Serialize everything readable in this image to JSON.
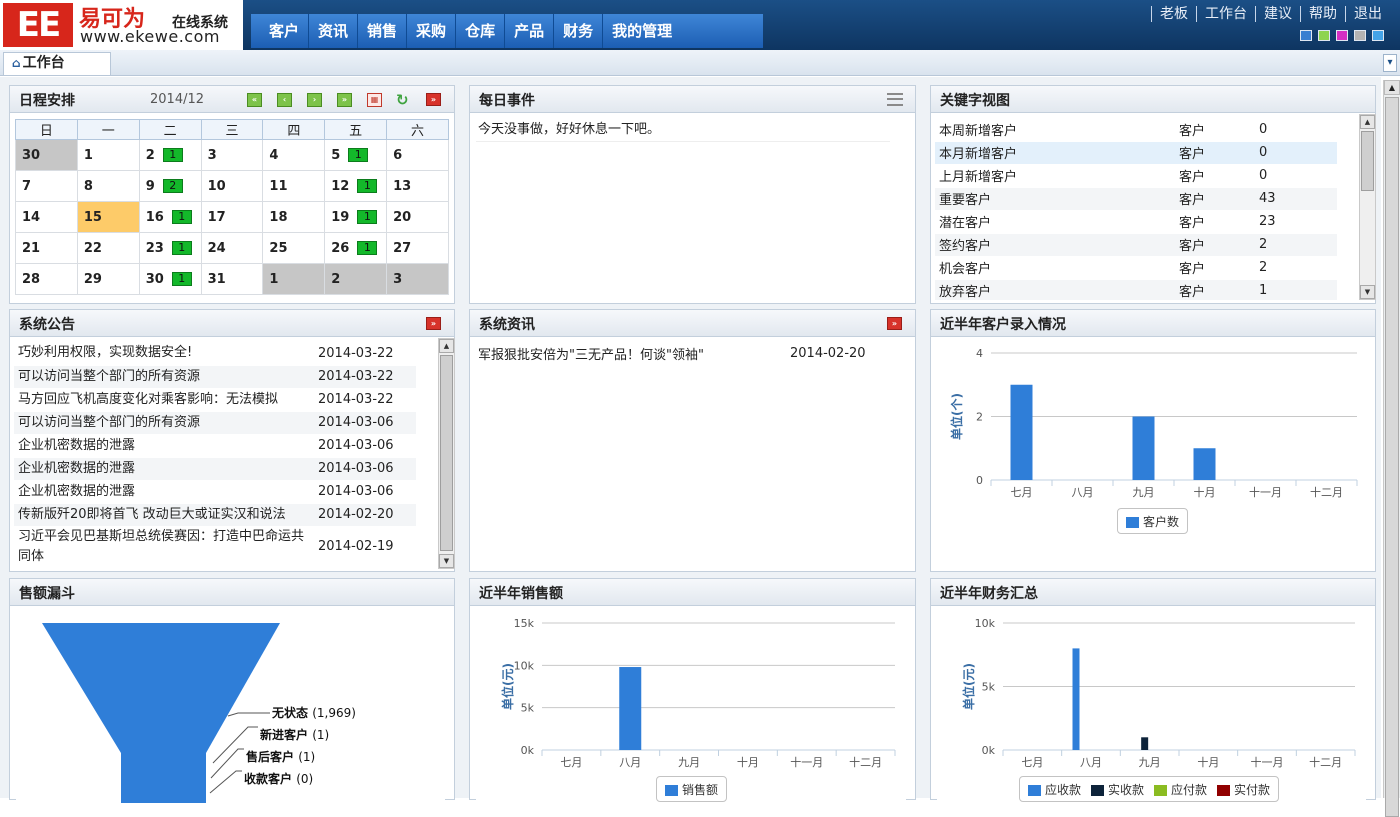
{
  "brand": {
    "mark": "EE",
    "name": "易可为",
    "sub": "在线系统",
    "url": "www.ekewe.com"
  },
  "nav": [
    "客户",
    "资讯",
    "销售",
    "采购",
    "仓库",
    "产品",
    "财务",
    "我的管理"
  ],
  "toplinks": [
    "老板",
    "工作台",
    "建议",
    "帮助",
    "退出"
  ],
  "swatches": [
    "#3a7fd0",
    "#8ed44f",
    "#d42fc4",
    "#b3b3b3",
    "#44a3e8"
  ],
  "tab": {
    "label": "工作台",
    "home_icon": "home-icon"
  },
  "schedule": {
    "title": "日程安排",
    "month": "2014/12",
    "weekdays": [
      "日",
      "一",
      "二",
      "三",
      "四",
      "五",
      "六"
    ],
    "weeks": [
      [
        {
          "d": "30",
          "s": "gray"
        },
        {
          "d": "1"
        },
        {
          "d": "2",
          "n": "1"
        },
        {
          "d": "3"
        },
        {
          "d": "4"
        },
        {
          "d": "5",
          "n": "1"
        },
        {
          "d": "6"
        }
      ],
      [
        {
          "d": "7"
        },
        {
          "d": "8"
        },
        {
          "d": "9",
          "n": "2"
        },
        {
          "d": "10"
        },
        {
          "d": "11"
        },
        {
          "d": "12",
          "n": "1"
        },
        {
          "d": "13"
        }
      ],
      [
        {
          "d": "14"
        },
        {
          "d": "15",
          "s": "today"
        },
        {
          "d": "16",
          "n": "1"
        },
        {
          "d": "17"
        },
        {
          "d": "18"
        },
        {
          "d": "19",
          "n": "1"
        },
        {
          "d": "20"
        }
      ],
      [
        {
          "d": "21"
        },
        {
          "d": "22"
        },
        {
          "d": "23",
          "n": "1"
        },
        {
          "d": "24"
        },
        {
          "d": "25"
        },
        {
          "d": "26",
          "n": "1"
        },
        {
          "d": "27"
        }
      ],
      [
        {
          "d": "28"
        },
        {
          "d": "29"
        },
        {
          "d": "30",
          "n": "1"
        },
        {
          "d": "31"
        },
        {
          "d": "1",
          "s": "gray"
        },
        {
          "d": "2",
          "s": "gray"
        },
        {
          "d": "3",
          "s": "gray"
        }
      ]
    ]
  },
  "daily": {
    "title": "每日事件",
    "text": "今天没事做，好好休息一下吧。"
  },
  "keywords": {
    "title": "关键字视图",
    "rows": [
      [
        "本周新增客户",
        "客户",
        "0"
      ],
      [
        "本月新增客户",
        "客户",
        "0"
      ],
      [
        "上月新增客户",
        "客户",
        "0"
      ],
      [
        "重要客户",
        "客户",
        "43"
      ],
      [
        "潜在客户",
        "客户",
        "23"
      ],
      [
        "签约客户",
        "客户",
        "2"
      ],
      [
        "机会客户",
        "客户",
        "2"
      ],
      [
        "放弃客户",
        "客户",
        "1"
      ]
    ]
  },
  "notice": {
    "title": "系统公告",
    "rows": [
      [
        "巧妙利用权限，实现数据安全!",
        "2014-03-22"
      ],
      [
        "可以访问当整个部门的所有资源",
        "2014-03-22"
      ],
      [
        "马方回应飞机高度变化对乘客影响：无法模拟",
        "2014-03-22"
      ],
      [
        "可以访问当整个部门的所有资源",
        "2014-03-06"
      ],
      [
        "企业机密数据的泄露",
        "2014-03-06"
      ],
      [
        "企业机密数据的泄露",
        "2014-03-06"
      ],
      [
        "企业机密数据的泄露",
        "2014-03-06"
      ],
      [
        "传新版歼20即将首飞 改动巨大或证实汉和说法",
        "2014-02-20"
      ],
      [
        "习近平会见巴基斯坦总统侯赛因：打造中巴命运共同体",
        "2014-02-19"
      ]
    ]
  },
  "news": {
    "title": "系统资讯",
    "rows": [
      [
        "军报狠批安倍为\"三无产品！何谈\"领袖\"",
        "2014-02-20"
      ]
    ]
  },
  "funnel": {
    "title": "售额漏斗",
    "stages": [
      {
        "name": "无状态",
        "value": "(1,969)"
      },
      {
        "name": "新进客户",
        "value": "(1)"
      },
      {
        "name": "售后客户",
        "value": "(1)"
      },
      {
        "name": "收款客户",
        "value": "(0)"
      }
    ]
  },
  "chart_data": [
    {
      "type": "bar",
      "title": "近半年客户录入情况",
      "categories": [
        "七月",
        "八月",
        "九月",
        "十月",
        "十一月",
        "十二月"
      ],
      "series": [
        {
          "name": "客户数",
          "values": [
            3,
            0,
            2,
            1,
            0,
            0
          ],
          "color": "#2f7ed8"
        }
      ],
      "ylabel": "单位(个)",
      "ylim": [
        0,
        4
      ],
      "yticks": [
        "0",
        "2",
        "4"
      ],
      "grid": true,
      "legend": "bottom"
    },
    {
      "type": "bar",
      "title": "近半年销售额",
      "categories": [
        "七月",
        "八月",
        "九月",
        "十月",
        "十一月",
        "十二月"
      ],
      "series": [
        {
          "name": "销售额",
          "values": [
            0,
            9800,
            0,
            0,
            0,
            0
          ],
          "color": "#2f7ed8"
        }
      ],
      "ylabel": "单位(元)",
      "ylim": [
        0,
        15000
      ],
      "yticks": [
        "0k",
        "5k",
        "10k",
        "15k"
      ],
      "grid": true,
      "legend": "bottom"
    },
    {
      "type": "bar",
      "title": "近半年财务汇总",
      "categories": [
        "七月",
        "八月",
        "九月",
        "十月",
        "十一月",
        "十二月"
      ],
      "series": [
        {
          "name": "应收款",
          "values": [
            0,
            8000,
            0,
            0,
            0,
            0
          ],
          "color": "#2f7ed8"
        },
        {
          "name": "实收款",
          "values": [
            0,
            0,
            1000,
            0,
            0,
            0
          ],
          "color": "#0d233a"
        },
        {
          "name": "应付款",
          "values": [
            0,
            0,
            0,
            0,
            0,
            0
          ],
          "color": "#8bbc21"
        },
        {
          "name": "实付款",
          "values": [
            0,
            0,
            0,
            0,
            0,
            0
          ],
          "color": "#910000"
        }
      ],
      "ylabel": "单位(元)",
      "ylim": [
        0,
        10000
      ],
      "yticks": [
        "0k",
        "5k",
        "10k"
      ],
      "grid": true,
      "legend": "bottom"
    }
  ]
}
